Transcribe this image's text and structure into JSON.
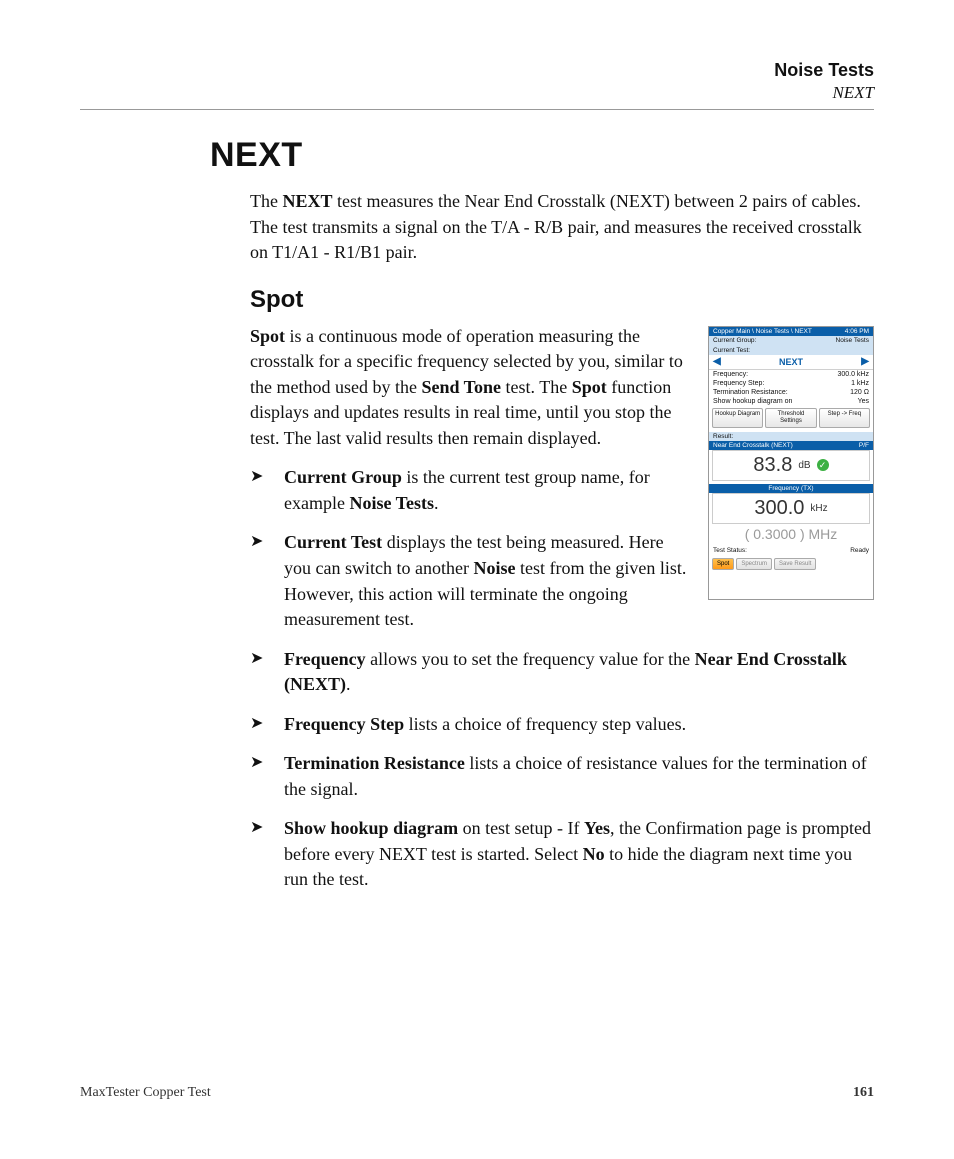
{
  "header": {
    "section": "Noise Tests",
    "sub": "NEXT"
  },
  "h1": "NEXT",
  "intro_parts": {
    "pre": "The ",
    "b1": "NEXT",
    "rest": " test measures the Near End Crosstalk (NEXT) between 2 pairs of cables. The test transmits a signal on the T/A - R/B pair, and measures the received crosstalk on T1/A1 - R1/B1 pair."
  },
  "h2": "Spot",
  "spot_para": {
    "b1": "Spot",
    "t1": " is a continuous mode of operation measuring the crosstalk for a specific frequency selected by you, similar to the method used by the ",
    "b2": "Send Tone",
    "t2": " test. The ",
    "b3": "Spot",
    "t3": " function displays and updates results in real time, until you stop the test. The last valid results then remain displayed."
  },
  "bullets": {
    "b1": {
      "bold": "Current Group",
      "t1": " is the current test group name, for example ",
      "bold2": "Noise Tests",
      "t2": "."
    },
    "b2": {
      "bold": "Current Test",
      "t1": " displays the test being measured. Here you can switch to another ",
      "bold2": "Noise",
      "t2": " test from the given list. However, this action will terminate the ongoing measurement test."
    },
    "b3": {
      "bold": "Frequency",
      "t1": " allows you to set the frequency value for the ",
      "bold2": "Near End Crosstalk (NEXT)",
      "t2": "."
    },
    "b4": {
      "bold": "Frequency Step",
      "t1": " lists a choice of frequency step values."
    },
    "b5": {
      "bold": "Termination Resistance",
      "t1": " lists a choice of resistance values for the termination of the signal."
    },
    "b6": {
      "bold": "Show hookup diagram",
      "t1": " on test setup - If ",
      "bold2": "Yes",
      "t2": ", the Confirmation page is prompted before every NEXT test is started. Select ",
      "bold3": "No",
      "t3": " to hide the diagram next time you run the test."
    }
  },
  "screenshot": {
    "breadcrumb": "Copper Main \\ Noise Tests \\ NEXT",
    "time": "4:06 PM",
    "current_group_lbl": "Current Group:",
    "current_group_val": "Noise Tests",
    "current_test_lbl": "Current Test:",
    "test_name": "NEXT",
    "freq_lbl": "Frequency:",
    "freq_val": "300.0 kHz",
    "freq_step_lbl": "Frequency Step:",
    "freq_step_val": "1 kHz",
    "term_lbl": "Termination Resistance:",
    "term_val": "120  Ω",
    "hookup_lbl": "Show hookup diagram on",
    "hookup_val": "Yes",
    "btn1": "Hookup Diagram",
    "btn2": "Threshold Settings",
    "btn3": "Step -> Freq",
    "result_hdr": "Result:",
    "result_bar_l": "Near End Crosstalk (NEXT)",
    "result_bar_r": "P/F",
    "big_val": "83.8",
    "big_unit": "dB",
    "freq_bar": "Frequency (TX)",
    "big2_val": "300.0",
    "big2_unit": "kHz",
    "sub": "( 0.3000 )  MHz",
    "status_lbl": "Test Status:",
    "status_val": "Ready",
    "tab1": "Spot",
    "tab2": "Spectrum",
    "tab3": "Save Result"
  },
  "footer": {
    "left": "MaxTester Copper Test",
    "page": "161"
  }
}
